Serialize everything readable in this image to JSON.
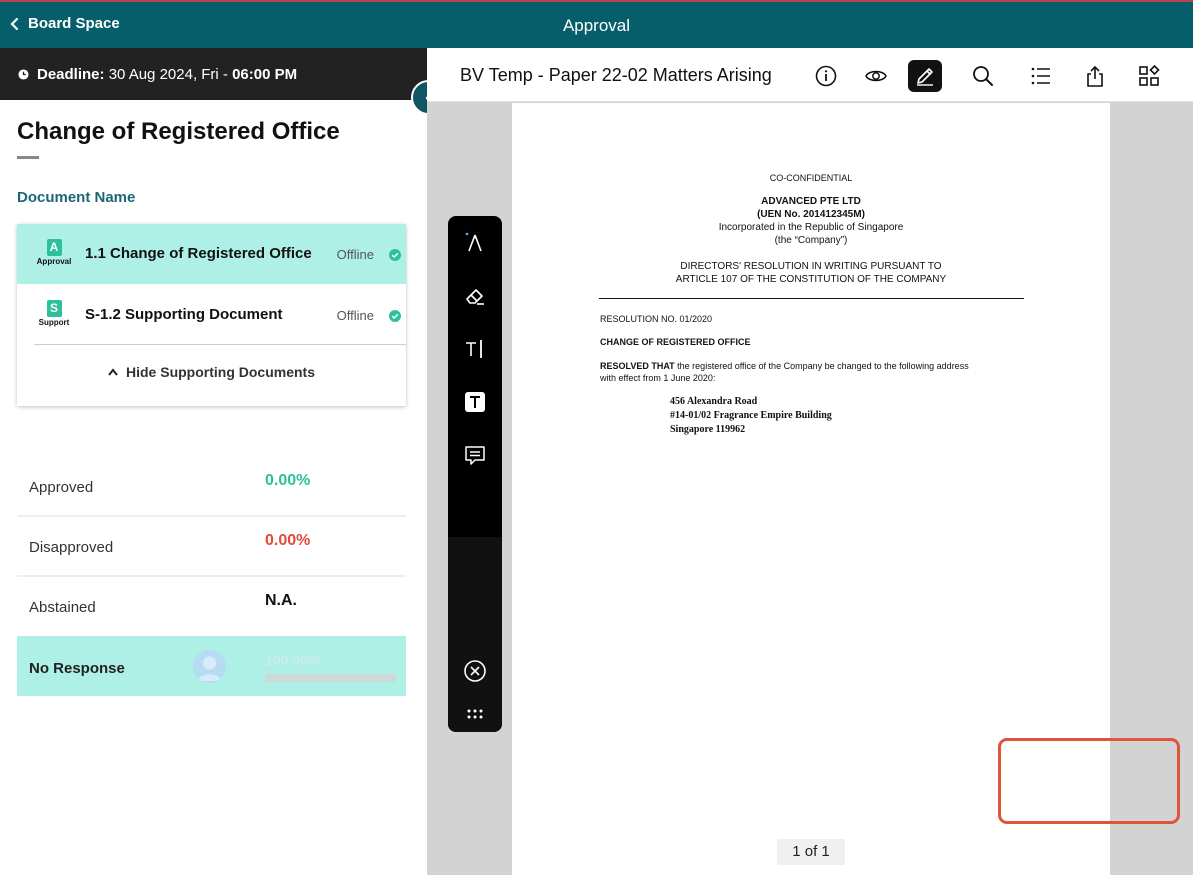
{
  "header": {
    "back_label": "Board Space",
    "title": "Approval"
  },
  "deadline": {
    "label": "Deadline:",
    "date": "30 Aug 2024, Fri - ",
    "time": "06:00 PM"
  },
  "resolution": {
    "title": "Change of Registered Office",
    "document_name_label": "Document Name"
  },
  "documents": [
    {
      "badge": "A",
      "badge_label": "Approval",
      "name": "1.1 Change of Registered Office",
      "status": "Offline"
    },
    {
      "badge": "S",
      "badge_label": "Support",
      "name": "S-1.2 Supporting Document",
      "status": "Offline"
    }
  ],
  "hide_supporting_label": "Hide Supporting Documents",
  "stats": {
    "approved": {
      "label": "Approved",
      "value": "0.00%",
      "color": "#2cc19b"
    },
    "disapproved": {
      "label": "Disapproved",
      "value": "0.00%",
      "color": "#e24a3a"
    },
    "abstained": {
      "label": "Abstained",
      "value": "N.A."
    },
    "no_response": {
      "label": "No Response",
      "value": "100.00%",
      "progress": 1.0
    }
  },
  "viewer": {
    "doc_title": "BV Temp - Paper 22-02 Matters Arising",
    "page_count": "1 of 1",
    "toolbar_icons": [
      "info-icon",
      "eye-icon",
      "pencil-icon",
      "search-icon",
      "list-icon",
      "share-icon",
      "apps-icon"
    ],
    "pen_tools": [
      "pen-icon",
      "eraser-icon",
      "text-cursor-icon",
      "text-box-icon",
      "comment-icon",
      "close-circle-icon",
      "more-dots-icon"
    ]
  },
  "pdf": {
    "confidential": "CO-CONFIDENTIAL",
    "company": "ADVANCED PTE LTD",
    "uen": "(UEN No. 201412345M)",
    "incorporated": "Incorporated in the Republic of Singapore",
    "company_alias": "(the “Company”)",
    "heading_line1": "DIRECTORS' RESOLUTION IN WRITING PURSUANT TO",
    "heading_line2": "ARTICLE 107 OF THE CONSTITUTION OF THE COMPANY",
    "resolution_no": "RESOLUTION NO. 01/2020",
    "subject": "CHANGE OF REGISTERED OFFICE",
    "resolved_bold": "RESOLVED THAT",
    "resolved_text": " the registered office of the Company be changed to the following address",
    "resolved_line2": "with effect from 1 June 2020:",
    "address": [
      "456 Alexandra Road",
      "#14-01/02 Fragrance Empire Building",
      "Singapore 119962"
    ]
  },
  "colors": {
    "header": "#075e6b",
    "accent": "#2cc19b",
    "highlight": "#aff0e6",
    "annotation": "#e0533d"
  }
}
